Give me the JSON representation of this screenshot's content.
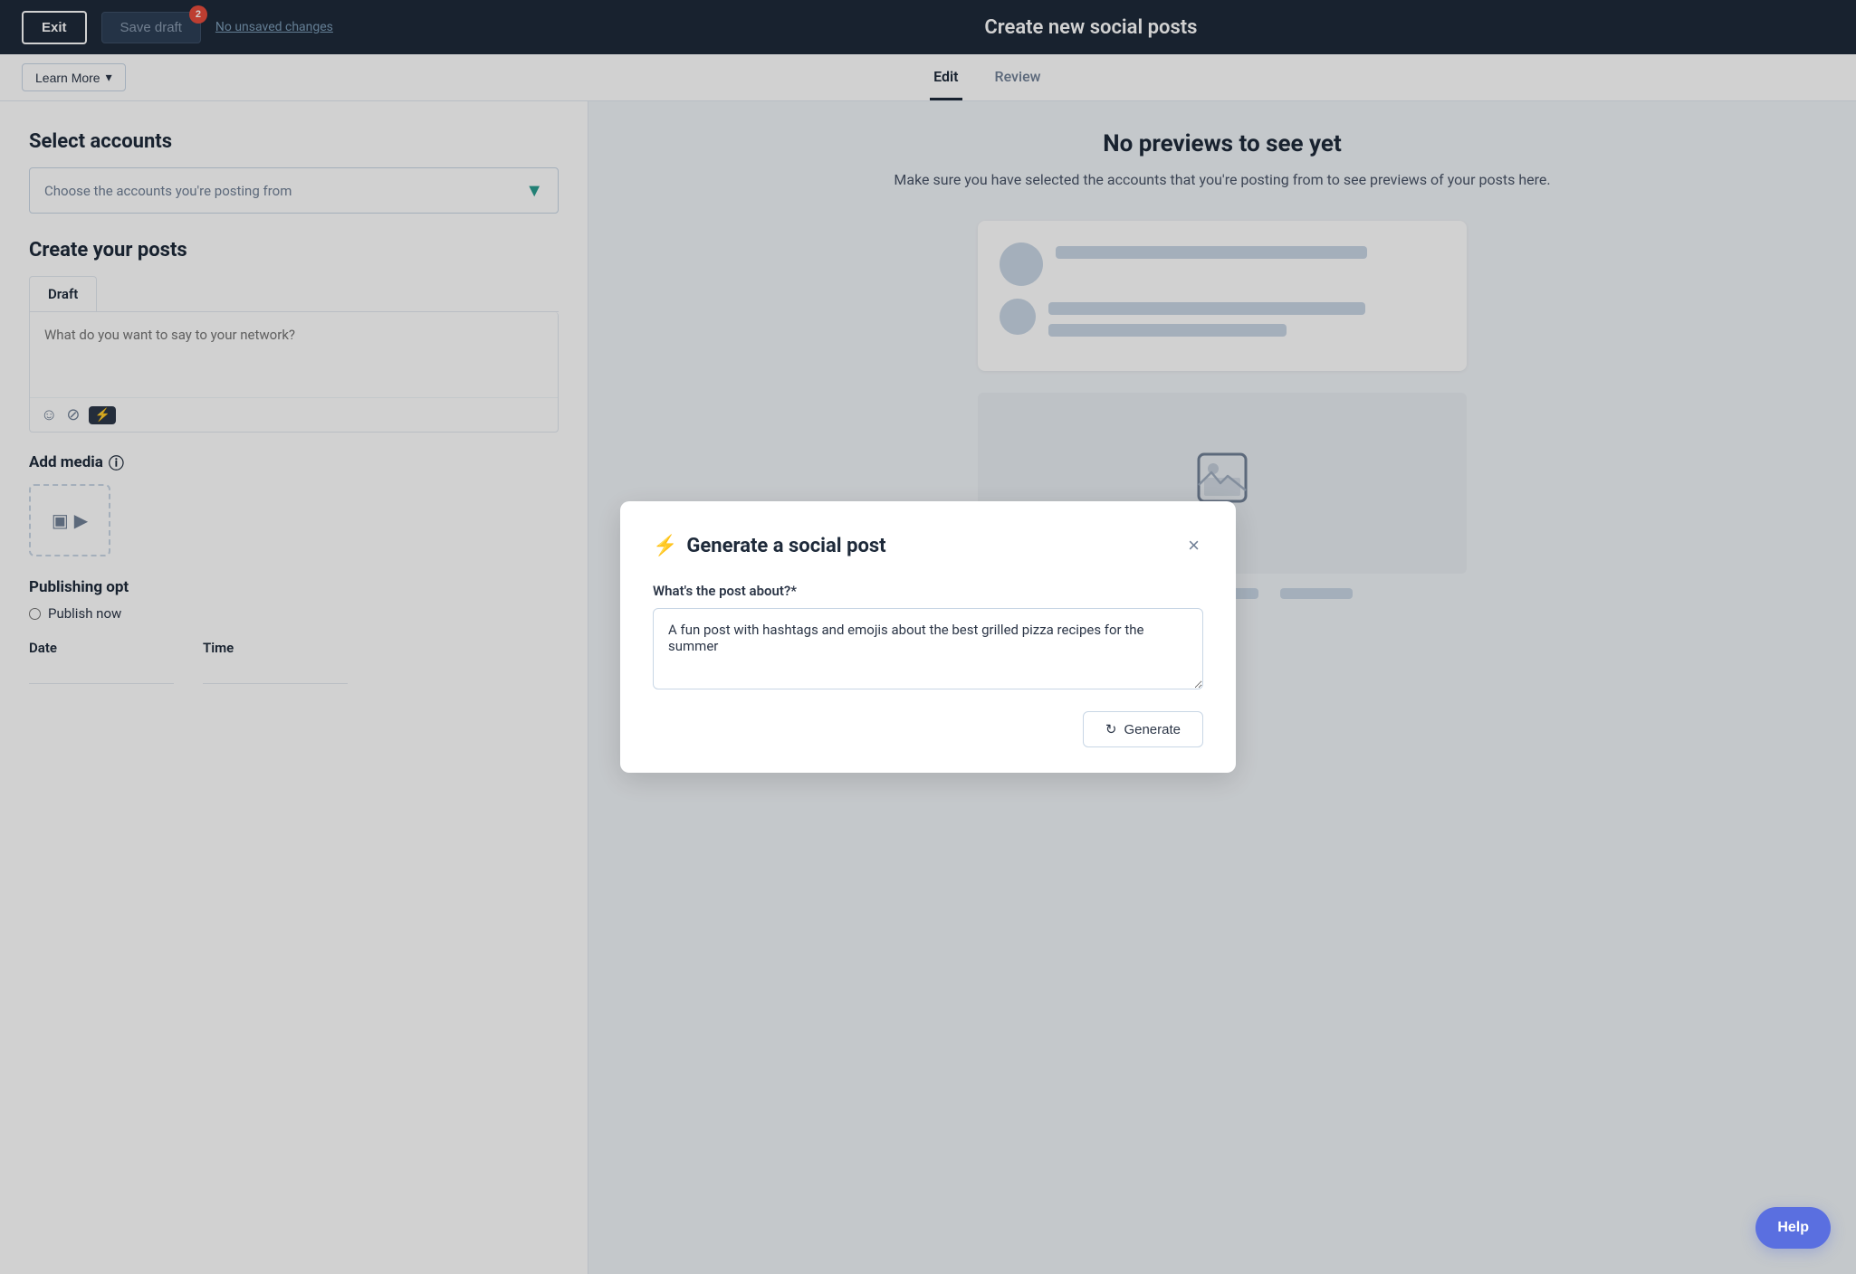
{
  "topNav": {
    "exit_label": "Exit",
    "save_draft_label": "Save draft",
    "badge_count": "2",
    "unsaved_label": "No unsaved changes",
    "title": "Create new social posts"
  },
  "secondNav": {
    "learn_more_label": "Learn More",
    "chevron": "▾",
    "tabs": [
      {
        "label": "Edit",
        "active": true
      },
      {
        "label": "Review",
        "active": false
      }
    ]
  },
  "leftPanel": {
    "select_accounts_title": "Select accounts",
    "account_placeholder": "Choose the accounts you're posting from",
    "chevron_down": "▼",
    "create_posts_title": "Create your posts",
    "draft_tab_label": "Draft",
    "post_placeholder": "What do you want to say to your network?",
    "toolbar": {
      "emoji_icon": "☺",
      "attach_icon": "⊘",
      "generate_icon": "⚡"
    },
    "add_media_title": "Add media",
    "info_icon": "ⓘ",
    "media_icons": [
      "▣",
      "▶"
    ],
    "publishing_title": "Publishing opt",
    "publish_now_label": "Publish now",
    "date_label": "Date",
    "time_label": "Time"
  },
  "rightPanel": {
    "no_preview_title": "No previews to see yet",
    "no_preview_text": "Make sure you have selected the accounts that you're posting from to see previews of your posts here."
  },
  "modal": {
    "title": "Generate a social post",
    "lightning_icon": "⚡",
    "question_label": "What's the post about?*",
    "textarea_value": "A fun post with hashtags and emojis about the best grilled pizza recipes for the summer",
    "generate_label": "Generate",
    "refresh_icon": "↻",
    "close_icon": "×"
  },
  "help": {
    "label": "Help"
  }
}
